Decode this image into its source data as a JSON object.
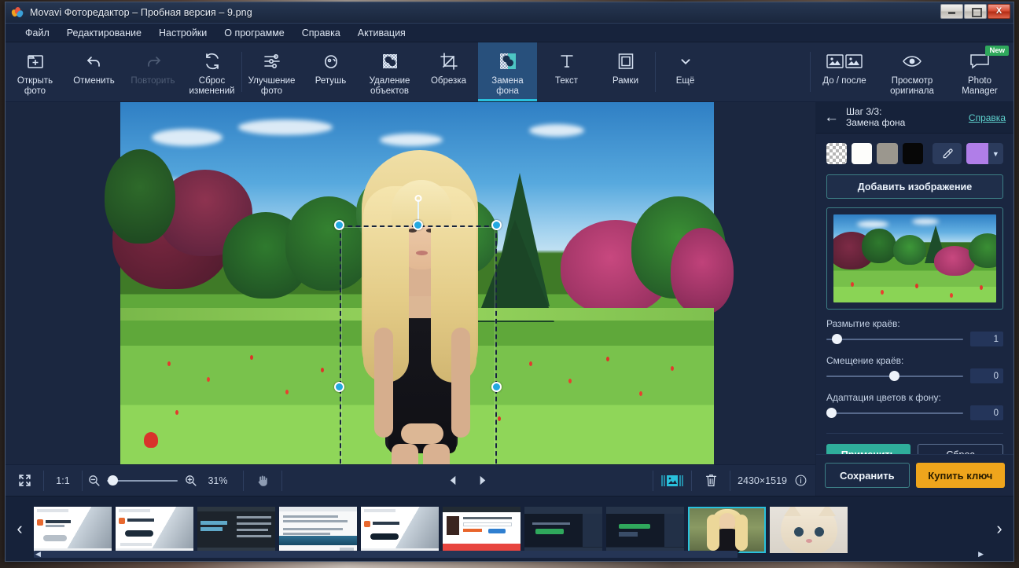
{
  "window": {
    "title": "Movavi Фоторедактор – Пробная версия – 9.png",
    "minimize_label": "–",
    "maximize_label": "□",
    "close_label": "X"
  },
  "menubar": {
    "items": [
      {
        "label": "Файл"
      },
      {
        "label": "Редактирование"
      },
      {
        "label": "Настройки"
      },
      {
        "label": "О программе"
      },
      {
        "label": "Справка"
      },
      {
        "label": "Активация"
      }
    ]
  },
  "toolbar": {
    "items": [
      {
        "label": "Открыть\nфото",
        "icon": "open-photo-icon",
        "state": "normal"
      },
      {
        "label": "Отменить",
        "icon": "undo-icon",
        "state": "normal"
      },
      {
        "label": "Повторить",
        "icon": "redo-icon",
        "state": "disabled"
      },
      {
        "label": "Сброс\nизменений",
        "icon": "reset-changes-icon",
        "state": "normal"
      },
      {
        "label": "Улучшение\nфото",
        "icon": "adjust-sliders-icon",
        "state": "normal"
      },
      {
        "label": "Ретушь",
        "icon": "retouch-face-icon",
        "state": "normal"
      },
      {
        "label": "Удаление\nобъектов",
        "icon": "object-removal-icon",
        "state": "normal"
      },
      {
        "label": "Обрезка",
        "icon": "crop-icon",
        "state": "normal"
      },
      {
        "label": "Замена\nфона",
        "icon": "background-replace-icon",
        "state": "active"
      },
      {
        "label": "Текст",
        "icon": "text-icon",
        "state": "normal"
      },
      {
        "label": "Рамки",
        "icon": "frames-icon",
        "state": "normal"
      },
      {
        "label": "Ещё",
        "icon": "chevron-down-icon",
        "state": "normal"
      }
    ],
    "right_items": [
      {
        "label": "До / после",
        "icon": "before-after-icon",
        "badge": ""
      },
      {
        "label": "Просмотр\nоригинала",
        "icon": "eye-icon",
        "badge": ""
      },
      {
        "label": "Photo\nManager",
        "icon": "photo-manager-icon",
        "badge": "New"
      }
    ]
  },
  "canvas_bar": {
    "fit_icon": "fit-to-screen-icon",
    "actual_size_label": "1:1",
    "zoom_out_icon": "zoom-out-icon",
    "zoom_in_icon": "zoom-in-icon",
    "zoom_percent": "31%",
    "hand_icon": "hand-tool-icon",
    "prev_icon": "prev-image-icon",
    "next_icon": "next-image-icon",
    "filmstrip_toggle_icon": "filmstrip-toggle-icon",
    "delete_icon": "trash-icon",
    "dimensions": "2430×1519",
    "info_icon": "info-icon"
  },
  "right_panel": {
    "back_icon": "back-arrow-icon",
    "title": "Шаг 3/3:\nЗамена фона",
    "help_label": "Справка",
    "swatches": [
      {
        "name": "transparent",
        "color": "checker"
      },
      {
        "name": "white",
        "color": "#fdfdfb"
      },
      {
        "name": "gray",
        "color": "#9b978e"
      },
      {
        "name": "black",
        "color": "#070707"
      }
    ],
    "eyedropper_icon": "eyedropper-icon",
    "custom_color": "#b07ee8",
    "color_caret_icon": "chevron-down-icon",
    "add_image_label": "Добавить изображение",
    "background_preview_name": "background-preview-image",
    "sliders": [
      {
        "label": "Размытие краёв:",
        "value": "1",
        "position_pct": 4
      },
      {
        "label": "Смещение краёв:",
        "value": "0",
        "position_pct": 48
      },
      {
        "label": "Адаптация цветов к фону:",
        "value": "0",
        "position_pct": 1
      }
    ],
    "apply_label": "Применить",
    "reset_label": "Сброс",
    "save_label": "Сохранить",
    "buy_label": "Купить ключ"
  },
  "filmstrip": {
    "prev_icon": "filmstrip-prev-icon",
    "next_icon": "filmstrip-next-icon",
    "thumbnails": [
      {
        "name": "thumb-movavi-landing-1",
        "selected": false
      },
      {
        "name": "thumb-movavi-landing-2",
        "selected": false
      },
      {
        "name": "thumb-article-dark",
        "selected": false
      },
      {
        "name": "thumb-article-list",
        "selected": false
      },
      {
        "name": "thumb-movavi-landing-3",
        "selected": false
      },
      {
        "name": "thumb-product-page",
        "selected": false
      },
      {
        "name": "thumb-editor-dark-1",
        "selected": false
      },
      {
        "name": "thumb-editor-dark-2",
        "selected": false
      },
      {
        "name": "thumb-blonde-woman",
        "selected": true
      },
      {
        "name": "thumb-cat",
        "selected": false
      }
    ]
  },
  "theme": {
    "accent": "#29c0dc",
    "panel_bg": "#1a2640",
    "toolbar_bg": "#1d2a45",
    "apply_green": "#2fae9b",
    "buy_yellow": "#efa51c",
    "link_teal": "#5fd3cf"
  }
}
